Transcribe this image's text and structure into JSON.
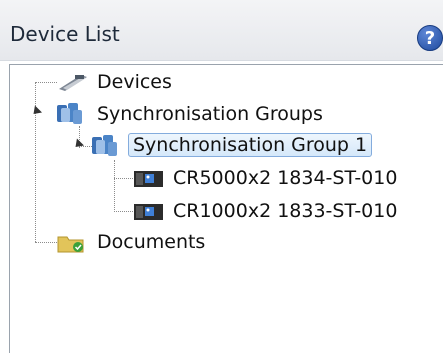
{
  "panel": {
    "title": "Device List",
    "help_icon": "help-icon",
    "help_symbol": "?"
  },
  "tree": {
    "devices": {
      "label": "Devices",
      "icon": "devices-icon"
    },
    "sync_groups": {
      "label": "Synchronisation Groups",
      "icon": "sync-groups-icon",
      "expanded": true
    },
    "sync_group_1": {
      "label": "Synchronisation Group 1",
      "icon": "sync-group-icon",
      "expanded": true,
      "selected": true
    },
    "device_1": {
      "label": "CR5000x2 1834-ST-010",
      "icon": "datalogger-icon"
    },
    "device_2": {
      "label": "CR1000x2 1833-ST-010",
      "icon": "datalogger-icon"
    },
    "documents": {
      "label": "Documents",
      "icon": "documents-folder-icon"
    }
  },
  "colors": {
    "header_bg": "#e9ebef",
    "selection_border": "#84acdd",
    "selection_bg": "#d5e8fa",
    "help_blue": "#1e4a9e"
  }
}
